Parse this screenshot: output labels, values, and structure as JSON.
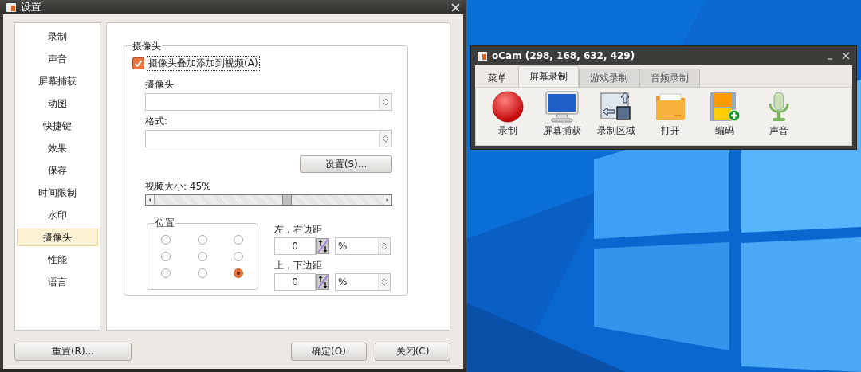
{
  "settings_window": {
    "title": "设置",
    "sidebar": {
      "items": [
        {
          "label": "录制",
          "selected": false
        },
        {
          "label": "声音",
          "selected": false
        },
        {
          "label": "屏幕捕获",
          "selected": false
        },
        {
          "label": "动图",
          "selected": false
        },
        {
          "label": "快捷键",
          "selected": false
        },
        {
          "label": "效果",
          "selected": false
        },
        {
          "label": "保存",
          "selected": false
        },
        {
          "label": "时间限制",
          "selected": false
        },
        {
          "label": "水印",
          "selected": false
        },
        {
          "label": "摄像头",
          "selected": true
        },
        {
          "label": "性能",
          "selected": false
        },
        {
          "label": "语言",
          "selected": false
        }
      ]
    },
    "camera_group": {
      "title": "摄像头",
      "overlay_checkbox": {
        "label": "摄像头叠加添加到视频(A)",
        "checked": true
      },
      "camera_label": "摄像头",
      "format_label": "格式:",
      "settings_button": "设置(S)...",
      "size_label": "视频大小: 45%",
      "size_slider": {
        "level": 0.58
      },
      "position": {
        "title": "位置",
        "options": [
          {
            "selected": false
          },
          {
            "selected": false
          },
          {
            "selected": false
          },
          {
            "selected": false
          },
          {
            "selected": false
          },
          {
            "selected": false
          },
          {
            "selected": false
          },
          {
            "selected": false
          },
          {
            "selected": true
          }
        ]
      },
      "margins": [
        {
          "label": "左，右边距",
          "value": "0",
          "unit": "%"
        },
        {
          "label": "上，下边距",
          "value": "0",
          "unit": "%"
        }
      ]
    },
    "buttons": [
      {
        "label": "重置(R)..."
      },
      {
        "label": "确定(O)"
      },
      {
        "label": "关闭(C)"
      }
    ]
  },
  "ocam_window": {
    "title": "oCam (298, 168, 632, 429)",
    "tabs": [
      {
        "label": "菜单",
        "selected": false
      },
      {
        "label": "屏幕录制",
        "selected": true
      },
      {
        "label": "游戏录制",
        "selected": false
      },
      {
        "label": "音频录制",
        "selected": false
      }
    ],
    "tools": [
      {
        "kind": "record",
        "label": "录制"
      },
      {
        "kind": "capture",
        "label": "屏幕捕获"
      },
      {
        "kind": "region",
        "label": "录制区域"
      },
      {
        "kind": "open",
        "label": "打开"
      },
      {
        "kind": "codec",
        "label": "编码"
      },
      {
        "kind": "sound",
        "label": "声音"
      }
    ]
  }
}
